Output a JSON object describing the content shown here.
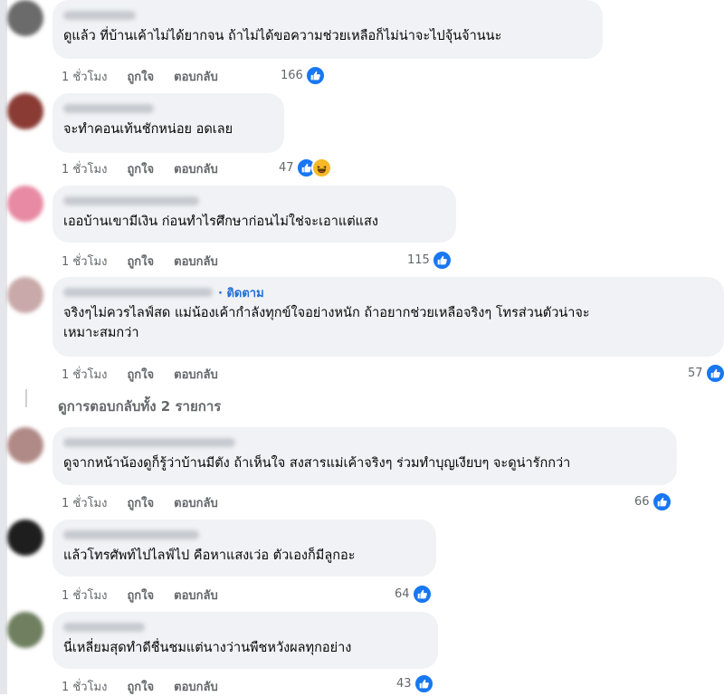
{
  "comments": [
    {
      "text": "ดูแล้ว ที่บ้านเค้าไม่ได้ยากจน ถ้าไม่ได้ขอความช่วยเหลือก็ไม่น่าจะไปจุ้นจ้านนะ",
      "time": "1 ชั่วโมง",
      "like": "ถูกใจ",
      "reply": "ตอบกลับ",
      "count": "166",
      "reactions": [
        "like-icon"
      ]
    },
    {
      "text": "จะทำคอนเท้นชักหน่อย อดเลย",
      "time": "1 ชั่วโมง",
      "like": "ถูกใจ",
      "reply": "ตอบกลับ",
      "count": "47",
      "reactions": [
        "like-icon",
        "haha-icon"
      ]
    },
    {
      "text": "เออบ้านเขามีเงิน ก่อนทำไรศึกษาก่อนไม่ใช่จะเอาแต่แสง",
      "time": "1 ชั่วโมง",
      "like": "ถูกใจ",
      "reply": "ตอบกลับ",
      "count": "115",
      "reactions": [
        "like-icon"
      ]
    },
    {
      "follow": "· ติดตาม",
      "text": "จริงๆไม่ควรไลฟ์สด แม่น้องเค้ากำลังทุกข์ใจอย่างหนัก ถ้าอยากช่วยเหลือจริงๆ โทรส่วนตัวน่าจะ\nเหมาะสมกว่า",
      "time": "1 ชั่วโมง",
      "like": "ถูกใจ",
      "reply": "ตอบกลับ",
      "count": "57",
      "reactions": [
        "like-icon"
      ]
    },
    {
      "text": "ดูจากหน้าน้องดูก็รู้ว่าบ้านมีตัง ถ้าเห็นใจ สงสารแม่เค้าจริงๆ ร่วมทำบุญเงียบๆ จะดูน่ารักกว่า",
      "time": "1 ชั่วโมง",
      "like": "ถูกใจ",
      "reply": "ตอบกลับ",
      "count": "66",
      "reactions": [
        "like-icon"
      ]
    },
    {
      "text": "แล้วโทรศัพท์ไปไลฟ์ไป คือหาแสงเว่อ ตัวเองก็มีลูกอะ",
      "time": "1 ชั่วโมง",
      "like": "ถูกใจ",
      "reply": "ตอบกลับ",
      "count": "64",
      "reactions": [
        "like-icon"
      ]
    },
    {
      "text": "นี่เหลี่ยมสุดทำดีชื่นชมแต่นางว่านพืชหวังผลทุกอย่าง",
      "time": "1 ชั่วโมง",
      "like": "ถูกใจ",
      "reply": "ตอบกลับ",
      "count": "43",
      "reactions": [
        "like-icon"
      ]
    }
  ],
  "view_replies": "ดูการตอบกลับทั้ง 2 รายการ",
  "colors": {
    "accent": "#1877f2",
    "bubble": "#f0f2f5",
    "meta": "#65676b",
    "follow": "#216fdb"
  }
}
